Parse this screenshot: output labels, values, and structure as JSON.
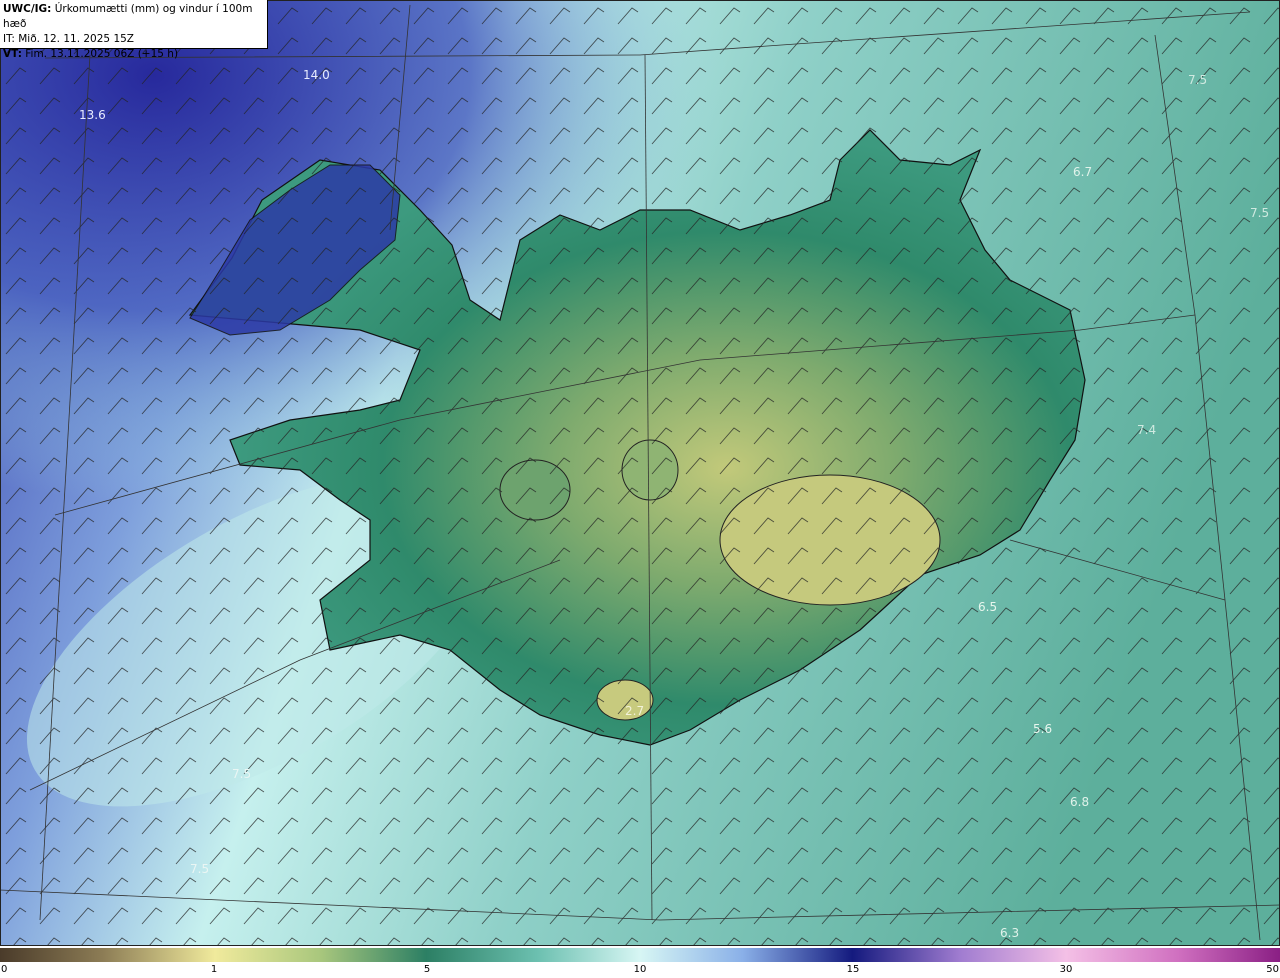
{
  "header": {
    "product": "UWC/IG:",
    "field": " Úrkomumætti (mm) og vindur í 100m hæð",
    "it": "IT: Mið. 12. 11. 2025 15Z",
    "vt_label": "VT:",
    "vt": " Fim. 13.11.2025 06Z (+15 h)"
  },
  "colors": {
    "sea_mid": "#9fdcd8",
    "land_green": "#2e8a6a",
    "land_yellow": "#b9c878",
    "high_blue": "#2a2fa0",
    "pale_cyan": "#cfeff0",
    "coast": "#111111",
    "grid": "#333333"
  },
  "map_labels": [
    {
      "text": "14.0"
    },
    {
      "text": "13.6"
    },
    {
      "text": "7.5"
    },
    {
      "text": "6.7"
    },
    {
      "text": "7.5"
    },
    {
      "text": "7.4"
    },
    {
      "text": "6.5"
    },
    {
      "text": "5.6"
    },
    {
      "text": "6.8"
    },
    {
      "text": "6.3"
    },
    {
      "text": "7.5"
    },
    {
      "text": "2.7"
    },
    {
      "text": "7.5"
    }
  ],
  "colorbar": {
    "ticks": [
      "0",
      "1",
      "5",
      "10",
      "15",
      "30",
      "50"
    ]
  }
}
